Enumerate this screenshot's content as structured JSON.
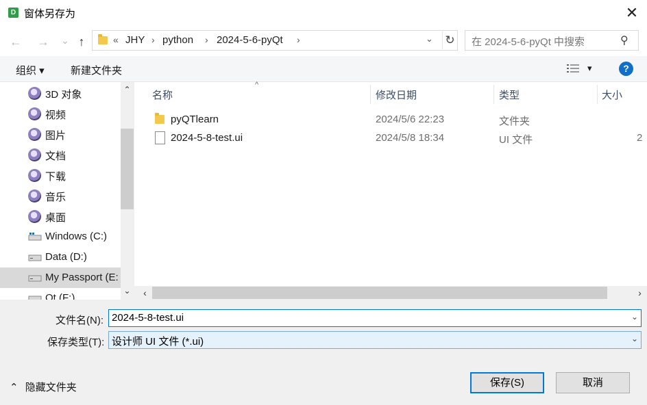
{
  "window": {
    "title": "窗体另存为",
    "app_icon_letter": "D",
    "close_glyph": "✕"
  },
  "nav": {
    "back_glyph": "←",
    "forward_glyph": "→",
    "recent_glyph": "⌄",
    "up_glyph": "↑",
    "overflow_glyph": "«",
    "breadcrumbs": [
      "JHY",
      "python",
      "2024-5-6-pyQt"
    ],
    "separator": "›",
    "dropdown_glyph": "⌄",
    "refresh_glyph": "↻",
    "search_placeholder": "在 2024-5-6-pyQt 中搜索",
    "search_glyph": "⚲"
  },
  "toolbar": {
    "organize_label": "组织 ▾",
    "new_folder_label": "新建文件夹",
    "view_dd_glyph": "▾",
    "help_glyph": "?"
  },
  "sidebar": {
    "scroll_up": "⌃",
    "scroll_down": "⌄",
    "items": [
      {
        "label": "3D 对象",
        "kind": "avatar"
      },
      {
        "label": "视频",
        "kind": "avatar"
      },
      {
        "label": "图片",
        "kind": "avatar"
      },
      {
        "label": "文档",
        "kind": "avatar"
      },
      {
        "label": "下载",
        "kind": "avatar"
      },
      {
        "label": "音乐",
        "kind": "avatar"
      },
      {
        "label": "桌面",
        "kind": "avatar"
      },
      {
        "label": "Windows (C:)",
        "kind": "windows-drive"
      },
      {
        "label": "Data (D:)",
        "kind": "drive"
      },
      {
        "label": "My Passport (E:",
        "kind": "drive",
        "selected": true
      },
      {
        "label": "Qt (F:)",
        "kind": "drive"
      }
    ]
  },
  "file_list": {
    "columns": {
      "name": "名称",
      "modified": "修改日期",
      "type": "类型",
      "size": "大小"
    },
    "sort_glyph": "^",
    "rows": [
      {
        "name": "pyQTlearn",
        "modified": "2024/5/6 22:23",
        "type": "文件夹",
        "size": "",
        "kind": "folder"
      },
      {
        "name": "2024-5-8-test.ui",
        "modified": "2024/5/8 18:34",
        "type": "UI 文件",
        "size": "2",
        "kind": "file"
      }
    ],
    "hscroll_left": "‹",
    "hscroll_right": "›"
  },
  "save_form": {
    "filename_label": "文件名(N):",
    "filename_value": "2024-5-8-test.ui",
    "filetype_label": "保存类型(T):",
    "filetype_value": "设计师 UI 文件 (*.ui)",
    "dd_glyph": "⌄"
  },
  "footer": {
    "hide_folders_label": "隐藏文件夹",
    "hide_folders_glyph": "⌃",
    "save_button": "保存(S)",
    "cancel_button": "取消"
  },
  "colors": {
    "accent": "#0078d7",
    "help": "#1070c9",
    "folder": "#f2c94c",
    "selection": "#d9d9d9"
  }
}
